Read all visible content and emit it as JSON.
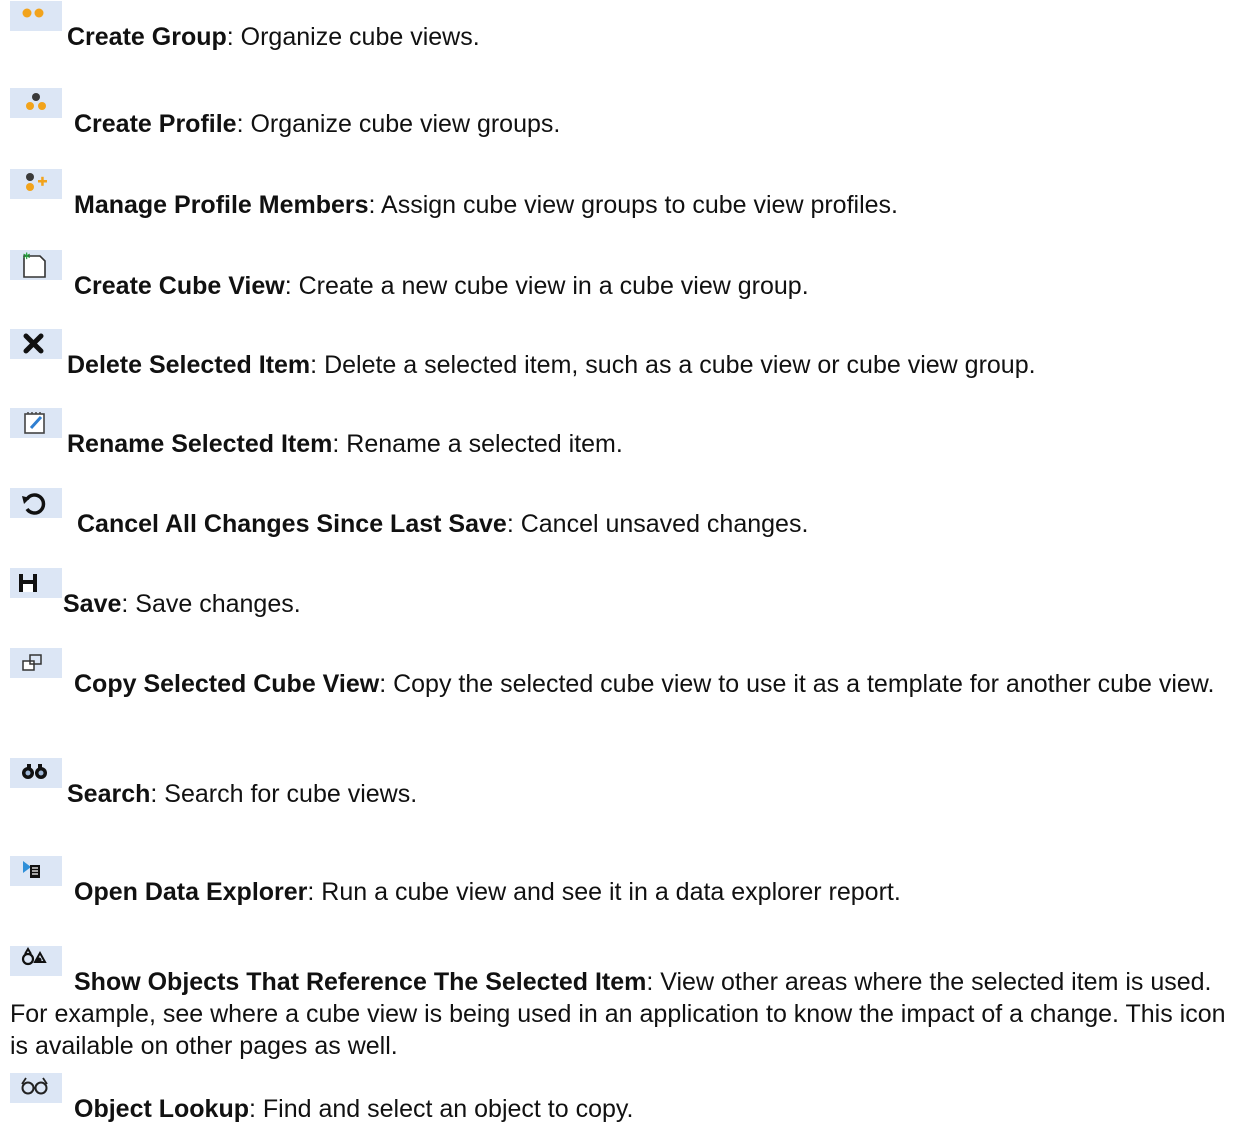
{
  "items": [
    {
      "icon": "create-group-icon",
      "title": "Create Group",
      "desc": ": Organize cube views."
    },
    {
      "icon": "create-profile-icon",
      "title": "Create Profile",
      "desc": ": Organize cube view groups."
    },
    {
      "icon": "manage-profile-members-icon",
      "title": "Manage Profile Members",
      "desc": ": Assign cube view groups to cube view profiles."
    },
    {
      "icon": "create-cube-view-icon",
      "title": "Create Cube View",
      "desc": ": Create a new cube view in a cube view group."
    },
    {
      "icon": "delete-icon",
      "title": "Delete Selected Item",
      "desc": ": Delete a selected item, such as a cube view or cube view group."
    },
    {
      "icon": "rename-icon",
      "title": "Rename Selected Item",
      "desc": ": Rename a selected item."
    },
    {
      "icon": "undo-icon",
      "title": "Cancel All Changes Since Last Save",
      "desc": ": Cancel unsaved changes."
    },
    {
      "icon": "save-icon",
      "title": "Save",
      "desc": ": Save changes."
    },
    {
      "icon": "copy-icon",
      "title": "Copy Selected Cube View",
      "desc": ": Copy the selected cube view to use it as a template for another cube view."
    },
    {
      "icon": "binoculars-icon",
      "title": "Search",
      "desc": ": Search for cube views."
    },
    {
      "icon": "data-explorer-icon",
      "title": "Open Data Explorer",
      "desc": ": Run a cube view and see it in a data explorer report."
    },
    {
      "icon": "references-icon",
      "title": "Show Objects That Reference The Selected Item",
      "desc": ": View other areas where the selected item is used. For example, see where a cube view is being used in an application to know the impact of a change. This icon is available on other pages as well."
    },
    {
      "icon": "glasses-icon",
      "title": "Object Lookup",
      "desc": ": Find and select an object to copy."
    }
  ]
}
